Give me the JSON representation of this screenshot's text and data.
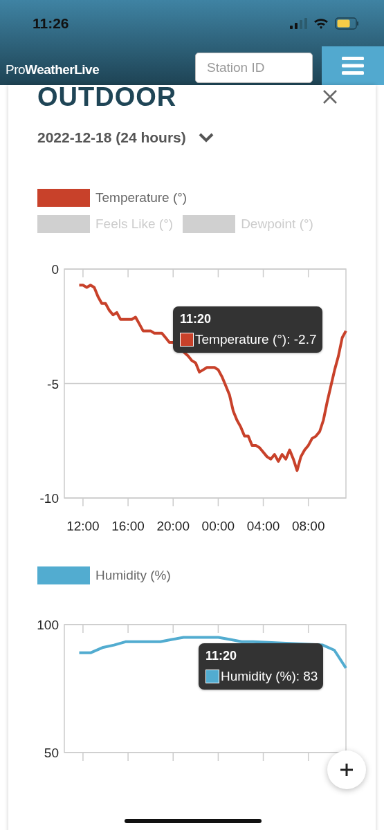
{
  "status_bar": {
    "time": "11:26"
  },
  "header": {
    "logo": "Pro**WeatherLive**",
    "search": {
      "placeholder": "Station ID"
    }
  },
  "panel": {
    "title": "OUTDOOR",
    "period": "2022-12-18 (24 hours)"
  },
  "charts": [
    {
      "legend": [
        {
          "visible": true
        },
        {
          "label": "Feels Like (°)",
          "visible": false
        },
        {
          "label": "Dewpoint (°)",
          "visible": false
        }
      ],
      "tooltip": {
        "time": "11:20",
        "text": "Temperature (°): -2.7"
      },
      "chart_data": {
        "type": "line",
        "categories": [
          null,
          "12:00",
          null,
          null,
          null,
          null,
          null,
          null,
          null,
          null,
          null,
          null,
          null,
          "16:00",
          null,
          null,
          null,
          null,
          null,
          null,
          null,
          null,
          null,
          null,
          null,
          "20:00",
          null,
          null,
          null,
          null,
          null,
          null,
          null,
          null,
          null,
          null,
          null,
          "00:00",
          null,
          null,
          null,
          null,
          null,
          null,
          null,
          null,
          null,
          null,
          null,
          "04:00",
          null,
          null,
          null,
          null,
          null,
          null,
          null,
          null,
          null,
          null,
          null,
          "08:00",
          null,
          null,
          null,
          null,
          null,
          null,
          null,
          null,
          null,
          null
        ],
        "series": [
          {
            "name": "Temperature (°)",
            "color": "#c8412a",
            "values": [
              -0.7,
              -0.7,
              -0.8,
              -0.7,
              -0.8,
              -1.2,
              -1.5,
              -1.5,
              -1.8,
              -2.0,
              -1.9,
              -2.2,
              -2.2,
              -2.2,
              -2.2,
              -2.1,
              -2.4,
              -2.7,
              -2.7,
              -2.7,
              -2.8,
              -2.8,
              -2.8,
              -3.0,
              -3.2,
              -3.2,
              null,
              null,
              null,
              -3.8,
              -4.0,
              -4.1,
              -4.5,
              -4.4,
              -4.3,
              -4.3,
              -4.3,
              -4.4,
              -4.7,
              -5.1,
              -5.5,
              -6.2,
              -6.6,
              -6.9,
              -7.3,
              -7.3,
              -7.7,
              -7.7,
              -7.8,
              -8.0,
              -8.2,
              -8.3,
              -8.1,
              -8.4,
              -8.1,
              -8.3,
              -7.9,
              -8.3,
              -8.8,
              -8.2,
              -7.9,
              -7.7,
              -7.4,
              -7.3,
              -7.1,
              -6.6,
              -5.8,
              -5.1,
              -4.4,
              -3.8,
              -3.0,
              -2.7
            ]
          }
        ],
        "ylim": [
          -10,
          0
        ],
        "yticks": [
          0,
          -5,
          -10
        ]
      }
    },
    {
      "legend": [
        {
          "visible": true
        }
      ],
      "tooltip": {
        "time": "11:20",
        "text": "Humidity (%): 83"
      },
      "chart_data": {
        "type": "line",
        "categories": [
          null,
          null,
          null,
          null,
          null,
          null,
          null,
          null,
          null,
          null,
          null,
          null,
          null,
          null,
          null,
          null,
          null,
          null,
          null,
          null,
          null,
          null,
          null,
          null
        ],
        "series": [
          {
            "name": "Humidity (%)",
            "color": "#52acd0",
            "values": [
              89,
              89,
              91,
              92,
              93.3,
              93.3,
              93.3,
              93.3,
              94.2,
              95,
              95,
              95,
              95,
              94.2,
              93.3,
              93.3,
              null,
              null,
              null,
              null,
              null,
              92,
              90,
              83
            ]
          }
        ],
        "ylim": [
          50,
          100
        ],
        "yticks": [
          100,
          50
        ]
      }
    }
  ]
}
